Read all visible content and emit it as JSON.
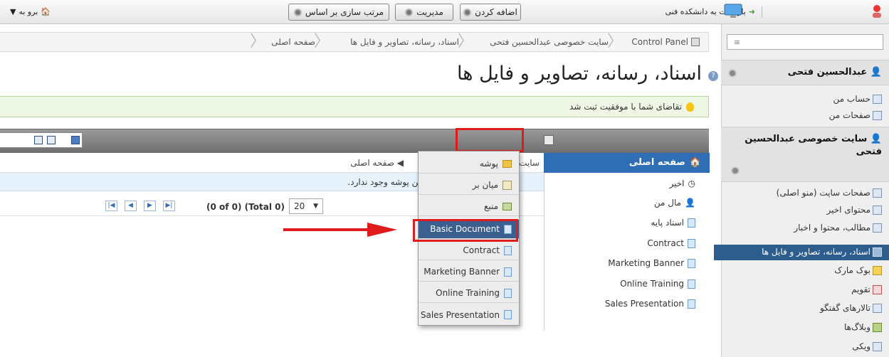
{
  "topbar": {
    "goto_label": "برو به",
    "back_label": "بازگشت به دانشکده فنی"
  },
  "sidebar": {
    "user_section": {
      "title": "عبدالحسین فتحی",
      "items": [
        "حساب من",
        "صفحات من"
      ]
    },
    "site_section": {
      "title": "سایت خصوصی عبدالحسین فتحی",
      "items": [
        "صفحات سایت (منو اصلی)",
        "محتوای اخیر",
        "مطالب، محتوا و اخبار",
        "اسناد، رسانه، تصاویر و فایل ها",
        "بوک مارک",
        "تقویم",
        "تالارهای گفتگو",
        "وبلاگ‌ها",
        "ویکی"
      ],
      "active_index": 3
    }
  },
  "breadcrumb": {
    "items": [
      "Control Panel",
      "سایت خصوصی عبدالحسین فتحی",
      "اسناد، رسانه، تصاویر و فایل ها",
      "صفحه اصلی"
    ]
  },
  "page": {
    "title": "اسناد، رسانه، تصاویر و فایل ها",
    "success_message": "تقاضای شما با موفقیت ثبت شد"
  },
  "toolbar": {
    "add_label": "اضافه کردن",
    "manage_label": "مدیریت",
    "sort_label": "مرتب سازی بر اساس"
  },
  "tree": {
    "home": "صفحه اصلی",
    "items": [
      "اخیر",
      "مال من",
      "اسناد پایه",
      "Contract",
      "Marketing Banner",
      "Online Training",
      "Sales Presentation"
    ]
  },
  "main": {
    "crumb_home": "صفحه اصلی",
    "crumb_site": "سایت",
    "empty_message": "ر این پوشه وجود ندارد.",
    "pager_total": "(0 of 0) (Total 0)",
    "page_size": "20"
  },
  "dropdown": {
    "items": [
      "پوشه",
      "میان بر",
      "منبع",
      "Basic Document",
      "Contract",
      "Marketing Banner",
      "Online Training",
      "Sales Presentation"
    ],
    "highlighted_index": 3
  },
  "colors": {
    "highlight_red": "#e01b1b",
    "tree_blue": "#2f6eb4",
    "active_nav": "#2d5d8d"
  }
}
